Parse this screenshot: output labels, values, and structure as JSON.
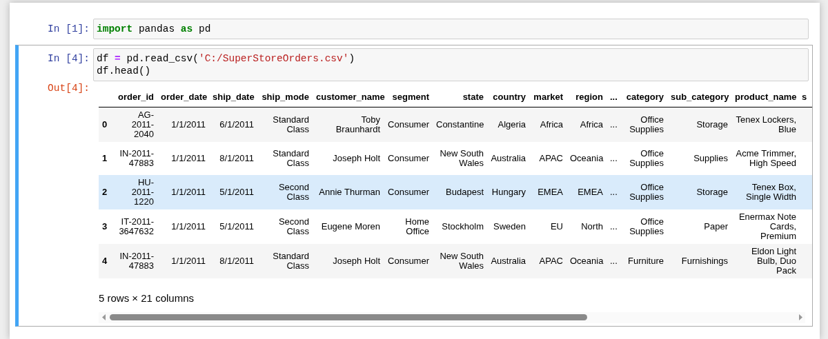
{
  "cells": [
    {
      "prompt": "In [1]:",
      "selected": false,
      "code": [
        [
          {
            "text": "import",
            "kind": "keyword"
          },
          {
            "text": " pandas ",
            "kind": "plain"
          },
          {
            "text": "as",
            "kind": "keyword"
          },
          {
            "text": " pd",
            "kind": "plain"
          }
        ]
      ]
    },
    {
      "prompt": "In [4]:",
      "selected": true,
      "code": [
        [
          {
            "text": "df ",
            "kind": "plain"
          },
          {
            "text": "=",
            "kind": "operator"
          },
          {
            "text": " pd.read_csv(",
            "kind": "plain"
          },
          {
            "text": "'C:/SuperStoreOrders.csv'",
            "kind": "string"
          },
          {
            "text": ")",
            "kind": "plain"
          }
        ],
        [
          {
            "text": "df.head()",
            "kind": "plain"
          }
        ]
      ],
      "output": {
        "prompt": "Out[4]:",
        "table": {
          "columns": [
            "order_id",
            "order_date",
            "ship_date",
            "ship_mode",
            "customer_name",
            "segment",
            "state",
            "country",
            "market",
            "region",
            "...",
            "category",
            "sub_category",
            "product_name",
            "s"
          ],
          "rows": [
            {
              "index": "0",
              "highlighted": false,
              "cells": [
                "AG-2011-2040",
                "1/1/2011",
                "6/1/2011",
                "Standard Class",
                "Toby Braunhardt",
                "Consumer",
                "Constantine",
                "Algeria",
                "Africa",
                "Africa",
                "...",
                "Office Supplies",
                "Storage",
                "Tenex Lockers, Blue"
              ]
            },
            {
              "index": "1",
              "highlighted": false,
              "cells": [
                "IN-2011-47883",
                "1/1/2011",
                "8/1/2011",
                "Standard Class",
                "Joseph Holt",
                "Consumer",
                "New South Wales",
                "Australia",
                "APAC",
                "Oceania",
                "...",
                "Office Supplies",
                "Supplies",
                "Acme Trimmer, High Speed"
              ]
            },
            {
              "index": "2",
              "highlighted": true,
              "cells": [
                "HU-2011-1220",
                "1/1/2011",
                "5/1/2011",
                "Second Class",
                "Annie Thurman",
                "Consumer",
                "Budapest",
                "Hungary",
                "EMEA",
                "EMEA",
                "...",
                "Office Supplies",
                "Storage",
                "Tenex Box, Single Width"
              ]
            },
            {
              "index": "3",
              "highlighted": false,
              "cells": [
                "IT-2011-3647632",
                "1/1/2011",
                "5/1/2011",
                "Second Class",
                "Eugene Moren",
                "Home Office",
                "Stockholm",
                "Sweden",
                "EU",
                "North",
                "...",
                "Office Supplies",
                "Paper",
                "Enermax Note Cards, Premium"
              ]
            },
            {
              "index": "4",
              "highlighted": false,
              "cells": [
                "IN-2011-47883",
                "1/1/2011",
                "8/1/2011",
                "Standard Class",
                "Joseph Holt",
                "Consumer",
                "New South Wales",
                "Australia",
                "APAC",
                "Oceania",
                "...",
                "Furniture",
                "Furnishings",
                "Eldon Light Bulb, Duo Pack"
              ]
            }
          ]
        },
        "summary": "5 rows × 21 columns"
      }
    }
  ]
}
